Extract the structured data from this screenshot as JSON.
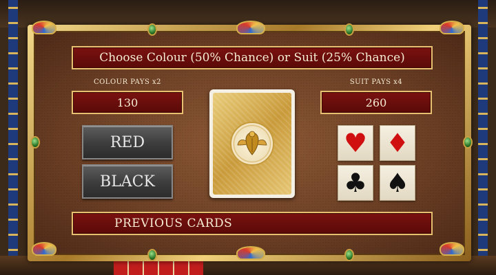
{
  "gamble": {
    "title": "Choose Colour (50% Chance) or Suit (25% Chance)",
    "colour_label": "COLOUR PAYS x2",
    "colour_value": "130",
    "suit_label": "SUIT PAYS x4",
    "suit_value": "260",
    "red_button": "RED",
    "black_button": "BLACK",
    "previous_cards": "PREVIOUS CARDS"
  },
  "suits": {
    "hearts": "♥",
    "diamonds": "♦",
    "clubs": "♣",
    "spades": "♠"
  },
  "colors": {
    "banner": "#7a1210",
    "frame_gold": "#d8b04a",
    "button_gray": "#4a4a4a",
    "suit_red": "#d01010"
  },
  "icons": {
    "card_emblem": "scarab-icon"
  }
}
